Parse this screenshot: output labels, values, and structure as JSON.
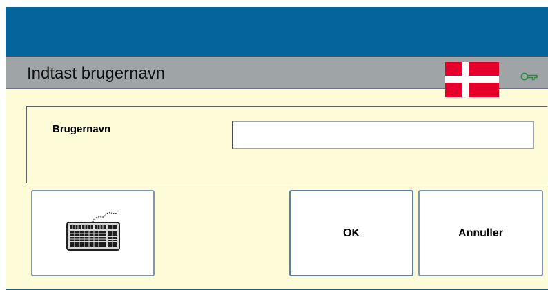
{
  "dialog": {
    "title": "Indtast brugernavn",
    "language_flag_icon": "denmark-flag-icon",
    "key_icon": "key-icon"
  },
  "field": {
    "label": "Brugernavn",
    "value": "",
    "placeholder": ""
  },
  "buttons": {
    "keyboard_icon": "keyboard-icon",
    "ok_label": "OK",
    "cancel_label": "Annuller"
  },
  "colors": {
    "backdrop": "#05649c",
    "titlebar": "#9fa4a6",
    "dialog_background": "#fefbd9",
    "flag_red": "#e4002b",
    "key_green": "#2d8a43"
  }
}
